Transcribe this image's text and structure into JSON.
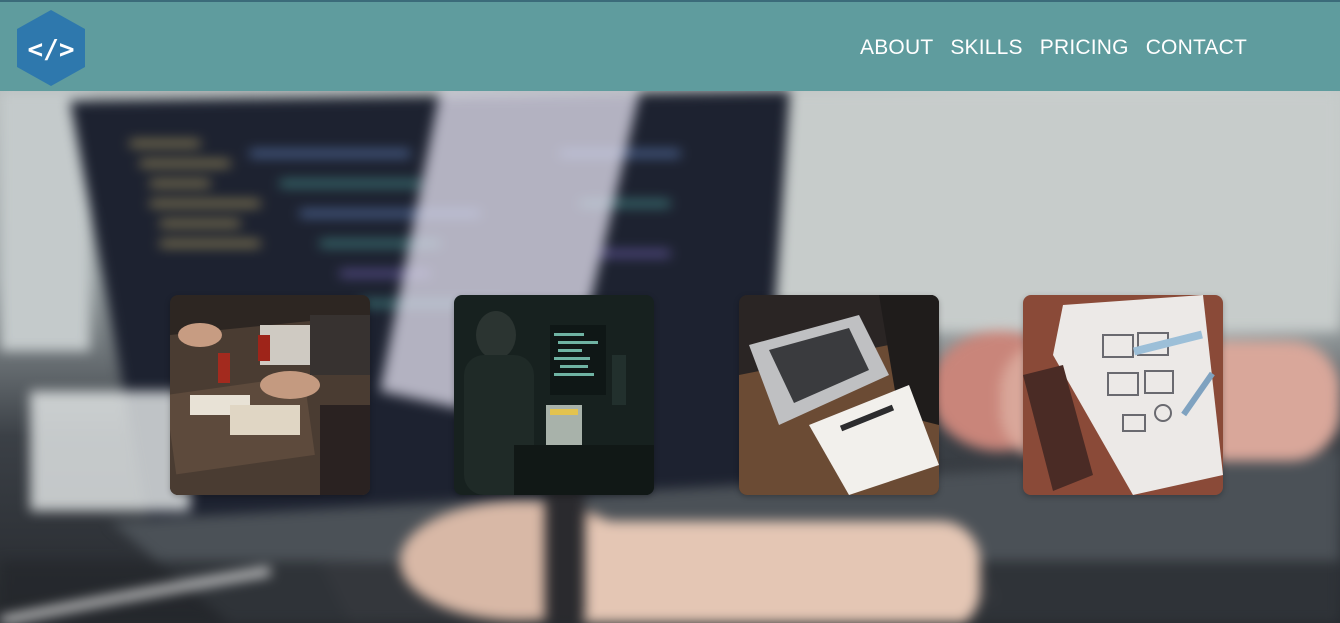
{
  "header": {
    "logo": {
      "icon": "code-brackets-icon",
      "glyph": "</>",
      "color": "#2e78ad"
    },
    "nav": [
      {
        "label": "ABOUT"
      },
      {
        "label": "SKILLS"
      },
      {
        "label": "PRICING"
      },
      {
        "label": "CONTACT"
      }
    ],
    "background_color": "#5f9c9e"
  },
  "hero": {
    "background": "blurred-laptop-coding-photo"
  },
  "gallery": [
    {
      "image": "team-desk-meeting-photo"
    },
    {
      "image": "developer-dark-monitors-photo"
    },
    {
      "image": "laptop-notebook-pen-photo"
    },
    {
      "image": "wireframe-sketch-phone-photo"
    }
  ]
}
